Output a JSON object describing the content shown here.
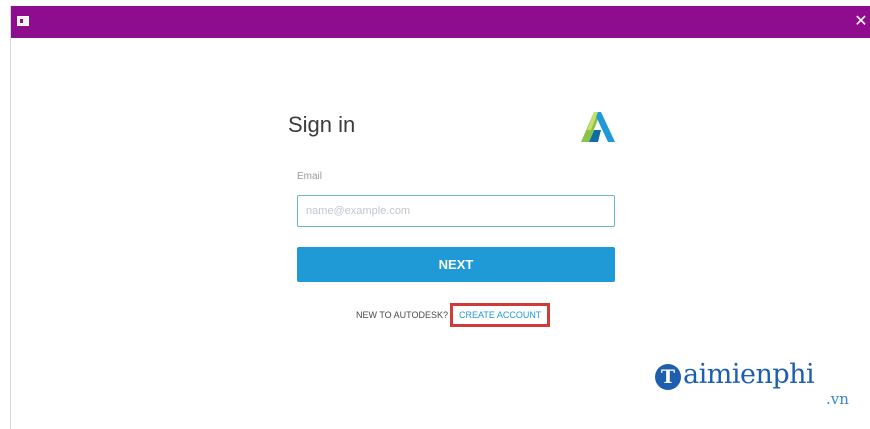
{
  "window": {
    "close_glyph": "✕",
    "titlebar_color": "#8e0c8e",
    "icon": "app-window-icon"
  },
  "signin": {
    "title": "Sign in",
    "logo_icon": "autodesk-logo-icon",
    "email_label": "Email",
    "email_value": "",
    "email_placeholder": "name@example.com",
    "next_label": "NEXT",
    "new_to_text": "NEW TO AUTODESK?",
    "create_account_label": "CREATE ACCOUNT",
    "accent_color": "#1f9ad6",
    "highlight_color": "#d23a3a"
  },
  "watermark": {
    "badge_letter": "T",
    "name": "aimienphi",
    "tld": ".vn"
  }
}
